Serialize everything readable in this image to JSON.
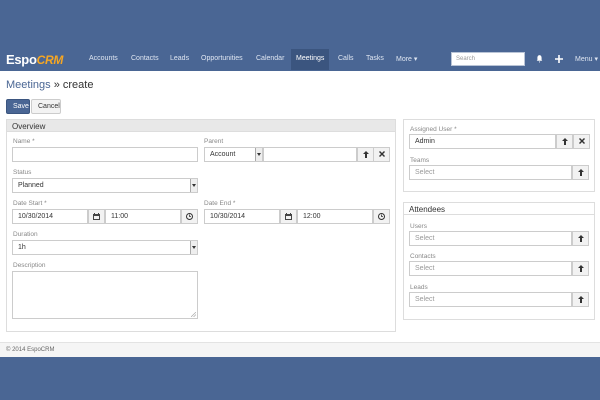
{
  "app": {
    "logo_main": "Espo",
    "logo_accent": "CRM"
  },
  "nav": {
    "items": [
      "Accounts",
      "Contacts",
      "Leads",
      "Opportunities",
      "Calendar",
      "Meetings",
      "Calls",
      "Tasks",
      "More ▾"
    ],
    "active": "Meetings",
    "search_placeholder": "Search",
    "menu_label": "Menu ▾",
    "icons": [
      "bell-icon",
      "plus-icon"
    ]
  },
  "page": {
    "breadcrumb_link": "Meetings",
    "breadcrumb_tail": " » create"
  },
  "buttons": {
    "save": "Save",
    "cancel": "Cancel"
  },
  "overview": {
    "heading": "Overview",
    "name_label": "Name *",
    "name_value": "",
    "parent_label": "Parent",
    "parent_type": "Account",
    "parent_value": "",
    "status_label": "Status",
    "status_value": "Planned",
    "date_start_label": "Date Start *",
    "date_start_date": "10/30/2014",
    "date_start_time": "11:00",
    "date_end_label": "Date End *",
    "date_end_date": "10/30/2014",
    "date_end_time": "12:00",
    "duration_label": "Duration",
    "duration_value": "1h",
    "description_label": "Description"
  },
  "side": {
    "assigned_user_label": "Assigned User *",
    "assigned_user_value": "Admin",
    "teams_label": "Teams",
    "teams_placeholder": "Select"
  },
  "attendees": {
    "heading": "Attendees",
    "users_label": "Users",
    "users_placeholder": "Select",
    "contacts_label": "Contacts",
    "contacts_placeholder": "Select",
    "leads_label": "Leads",
    "leads_placeholder": "Select"
  },
  "footer": {
    "text": "© 2014 EspoCRM"
  },
  "colors": {
    "navbar": "#4a6694",
    "active_tab": "#3b557f",
    "logo_accent": "#f5a623",
    "panel_head": "#e8e8e8"
  }
}
